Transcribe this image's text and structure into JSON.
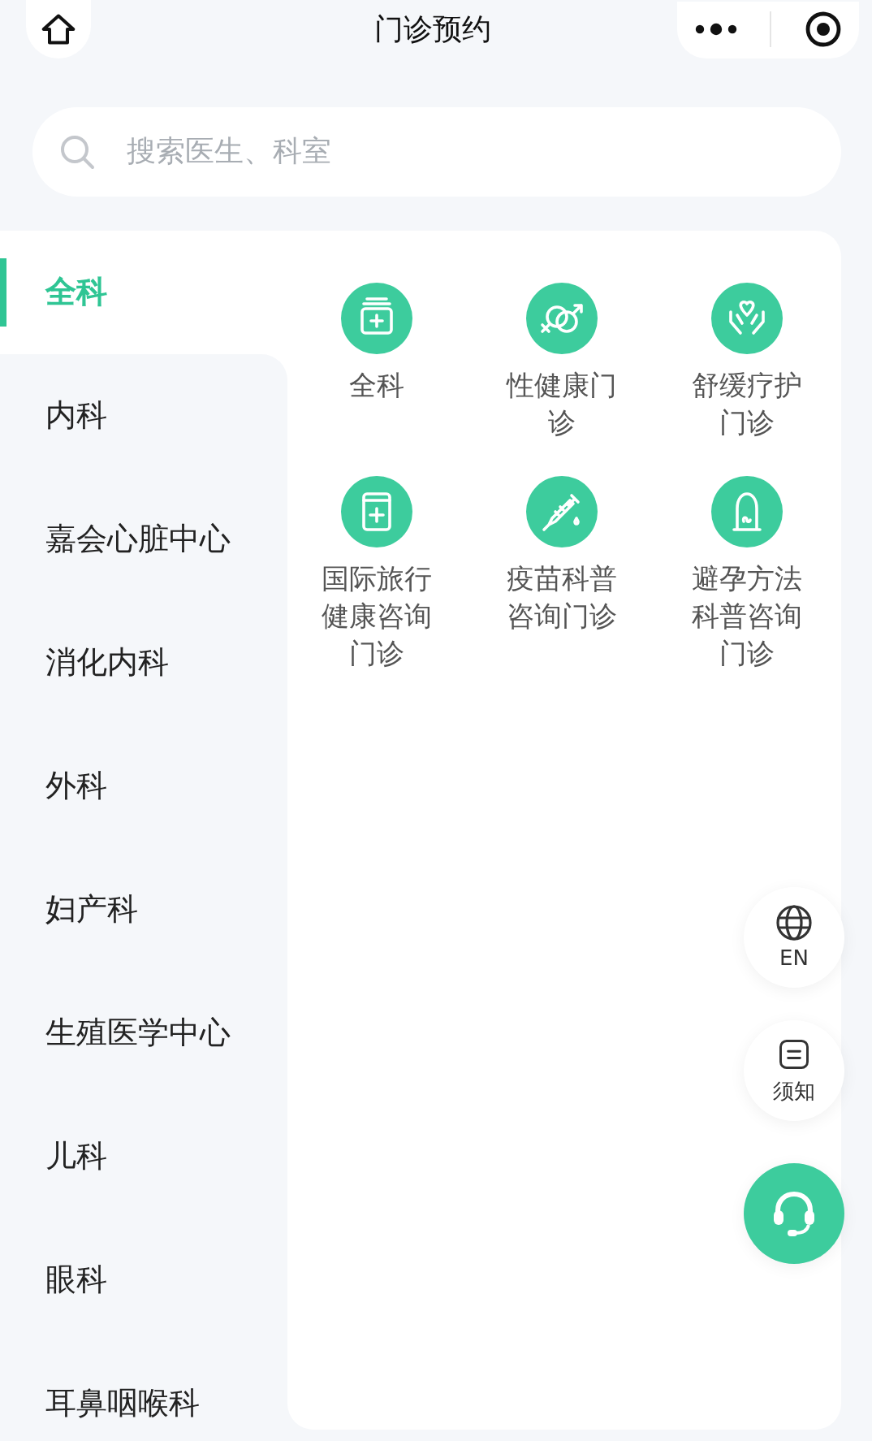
{
  "header": {
    "title": "门诊预约"
  },
  "search": {
    "placeholder": "搜索医生、科室"
  },
  "sidebar": {
    "items": [
      {
        "label": "全科",
        "selected": true
      },
      {
        "label": "内科",
        "selected": false
      },
      {
        "label": "嘉会心脏中心",
        "selected": false
      },
      {
        "label": "消化内科",
        "selected": false
      },
      {
        "label": "外科",
        "selected": false
      },
      {
        "label": "妇产科",
        "selected": false
      },
      {
        "label": "生殖医学中心",
        "selected": false
      },
      {
        "label": "儿科",
        "selected": false
      },
      {
        "label": "眼科",
        "selected": false
      },
      {
        "label": "耳鼻咽喉科",
        "selected": false
      }
    ]
  },
  "clinics": [
    {
      "label": "全科",
      "kind": "kit"
    },
    {
      "label": "性健康门诊",
      "kind": "gender"
    },
    {
      "label": "舒缓疗护门诊",
      "kind": "care"
    },
    {
      "label": "国际旅行健康咨询门诊",
      "kind": "medical"
    },
    {
      "label": "疫苗科普咨询门诊",
      "kind": "syringe"
    },
    {
      "label": "避孕方法科普咨询门诊",
      "kind": "condom"
    }
  ],
  "floating_buttons": [
    {
      "label": "EN",
      "kind": "language"
    },
    {
      "label": "须知",
      "kind": "notice"
    },
    {
      "kind": "support"
    }
  ]
}
